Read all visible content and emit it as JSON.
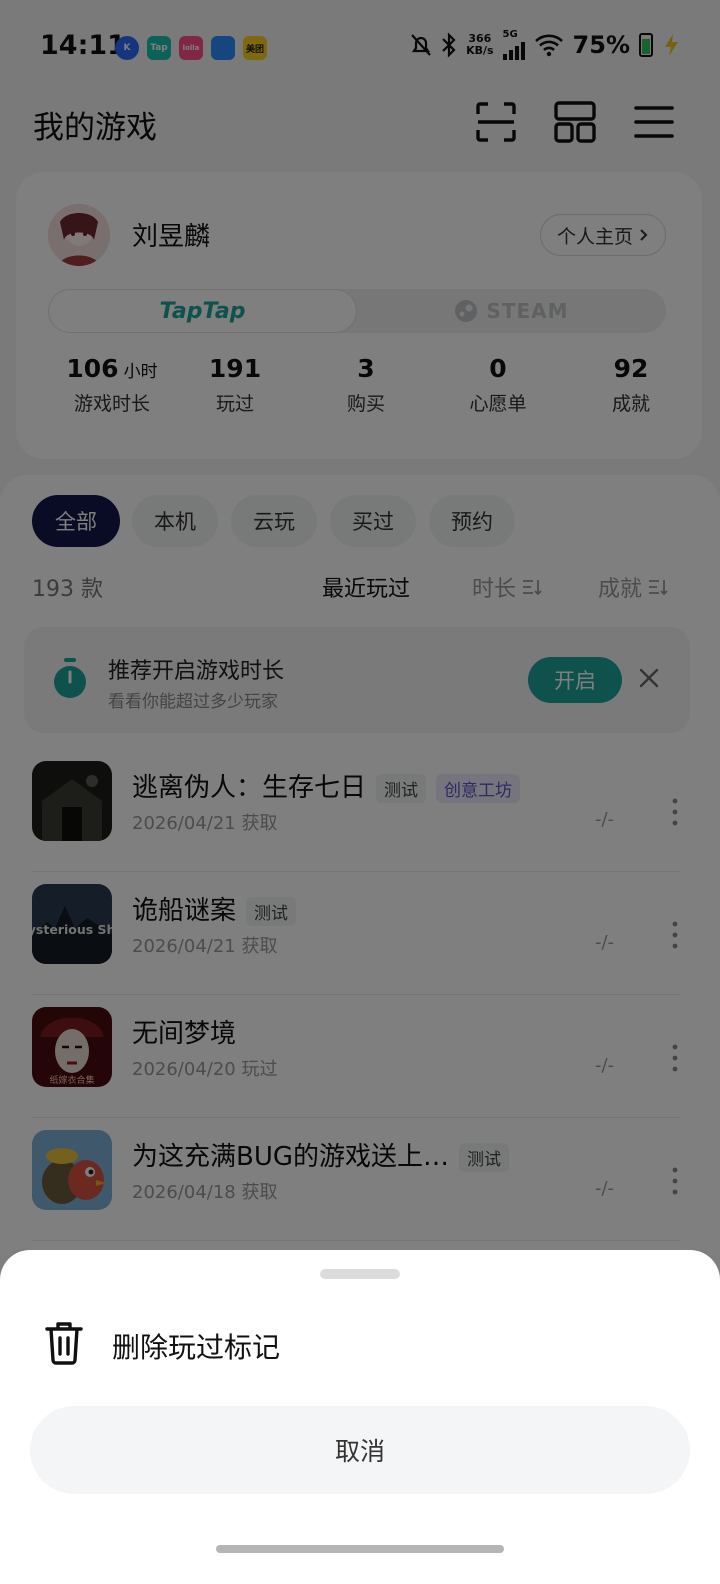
{
  "status": {
    "time": "14:11",
    "apps": [
      {
        "label": "K",
        "color": "#2f6bff"
      },
      {
        "label": "Tap",
        "color": "#19c2b0"
      },
      {
        "label": "lolla",
        "color": "#ff4f8a"
      },
      {
        "label": "",
        "color": "#2a8cff"
      },
      {
        "label": "美团",
        "color": "#ffd21f"
      }
    ],
    "net_speed_value": "366",
    "net_speed_unit": "KB/s",
    "network_type": "5G",
    "battery": "75%",
    "battery_level": 0.75
  },
  "header": {
    "title": "我的游戏",
    "icons": [
      "scan-icon",
      "grid-layout-icon",
      "menu-icon"
    ]
  },
  "profile": {
    "name": "刘昱麟",
    "home_button": "个人主页",
    "platforms": [
      "TapTap",
      "STEAM"
    ],
    "stats": [
      {
        "value": "106",
        "unit": "小时",
        "label": "游戏时长"
      },
      {
        "value": "191",
        "unit": "",
        "label": "玩过"
      },
      {
        "value": "3",
        "unit": "",
        "label": "购买"
      },
      {
        "value": "0",
        "unit": "",
        "label": "心愿单"
      },
      {
        "value": "92",
        "unit": "",
        "label": "成就"
      }
    ]
  },
  "library": {
    "filters": [
      "全部",
      "本机",
      "云玩",
      "买过",
      "预约"
    ],
    "active_filter": "全部",
    "count": "193 款",
    "sort_options": [
      "最近玩过",
      "时长",
      "成就"
    ],
    "active_sort": "最近玩过",
    "promo": {
      "title": "推荐开启游戏时长",
      "subtitle": "看看你能超过多少玩家",
      "button": "开启"
    },
    "games": [
      {
        "title": "逃离伪人：生存七日",
        "tags": [
          "测试",
          "创意工坊"
        ],
        "date": "2026/04/21 获取",
        "hours": "-/-"
      },
      {
        "title": "诡船谜案",
        "tags": [
          "测试"
        ],
        "date": "2026/04/21 获取",
        "hours": "-/-",
        "icon_text": "Mysterious Ship"
      },
      {
        "title": "无间梦境",
        "tags": [],
        "date": "2026/04/20 玩过",
        "hours": "-/-",
        "icon_text": "纸嫁衣合集"
      },
      {
        "title": "为这充满BUG的游戏送上…",
        "tags": [
          "测试"
        ],
        "date": "2026/04/18 获取",
        "hours": "-/-"
      }
    ]
  },
  "sheet": {
    "action": "删除玩过标记",
    "cancel": "取消"
  },
  "colors": {
    "accent": "#1ea398",
    "active_chip": "#15174a",
    "workshop_tag": "#5c54c6"
  }
}
